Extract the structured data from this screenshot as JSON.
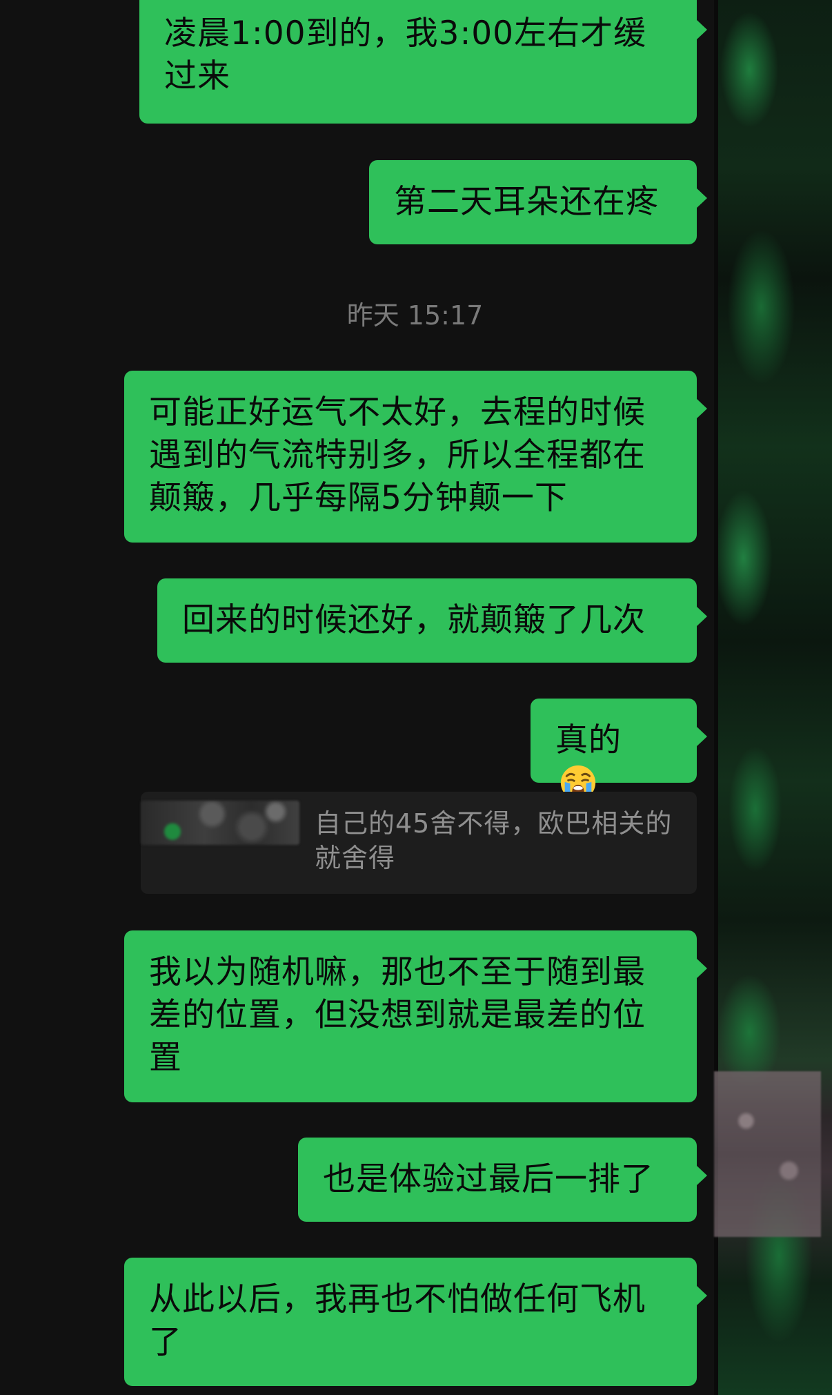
{
  "messages": [
    {
      "id": "m1",
      "text": "凌晨1:00到的，我3:00左右才缓过来"
    },
    {
      "id": "m2",
      "text": "第二天耳朵还在疼"
    },
    {
      "id": "m3",
      "text": "可能正好运气不太好，去程的时候遇到的气流特别多，所以全程都在颠簸，几乎每隔5分钟颠一下"
    },
    {
      "id": "m4",
      "text": "回来的时候还好，就颠簸了几次"
    },
    {
      "id": "m5",
      "text": "真的",
      "emoji": "😭"
    },
    {
      "id": "m6",
      "text": "我以为随机嘛，那也不至于随到最差的位置，但没想到就是最差的位置"
    },
    {
      "id": "m7",
      "text": "也是体验过最后一排了"
    },
    {
      "id": "m8",
      "text": "从此以后，我再也不怕做任何飞机了"
    }
  ],
  "timestamp": "昨天 15:17",
  "quote": {
    "text": "自己的45舍不得，欧巴相关的就舍得"
  },
  "colors": {
    "bubble": "#2fc05a",
    "background": "#111111",
    "timestamp": "#7a7a7a",
    "quote_bg": "#1d1d1d"
  }
}
